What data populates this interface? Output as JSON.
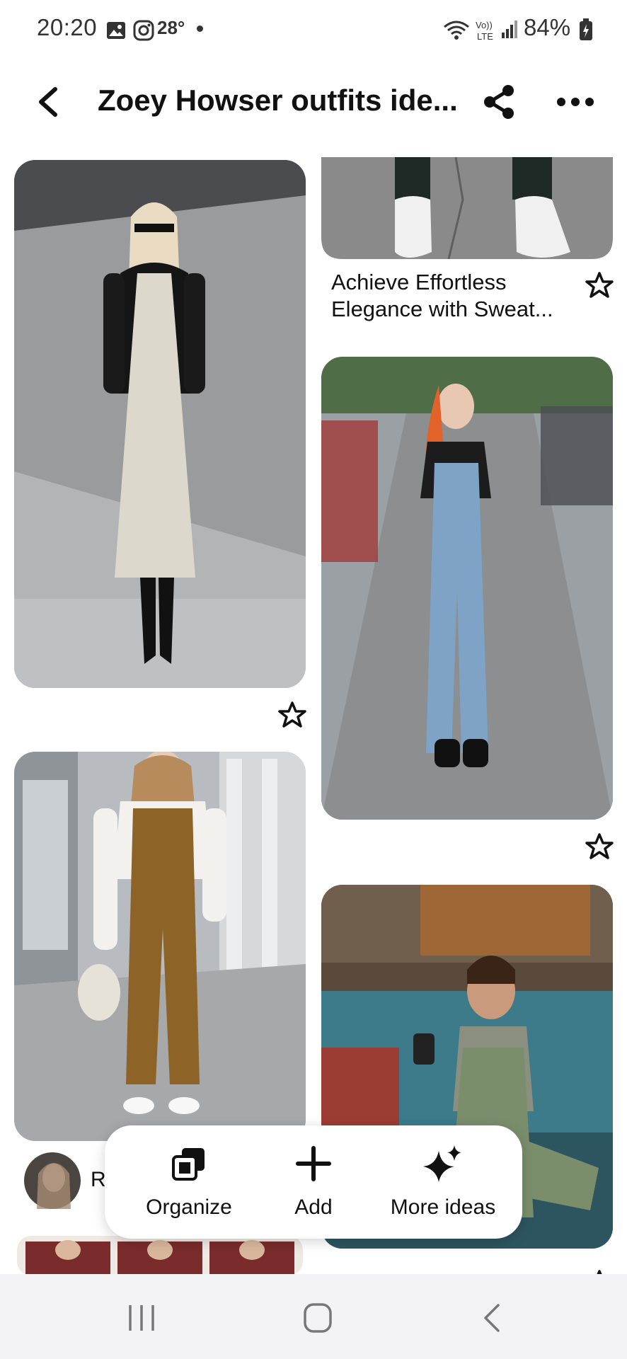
{
  "status_bar": {
    "time": "20:20",
    "temperature": "28°",
    "battery": "84%"
  },
  "header": {
    "title": "Zoey Howser outfits ide..."
  },
  "pins": [
    {
      "caption_line1": "Achieve Effortless",
      "caption_line2": "Elegance with Sweat..."
    }
  ],
  "creator": {
    "initial": "R"
  },
  "action_bar": {
    "organize": "Organize",
    "add": "Add",
    "more_ideas": "More ideas"
  },
  "icons": [
    "back-icon",
    "share-icon",
    "more-icon",
    "star-icon",
    "organize-icon",
    "plus-icon",
    "sparkle-icon",
    "recents-icon",
    "home-icon",
    "nav-back-icon"
  ]
}
